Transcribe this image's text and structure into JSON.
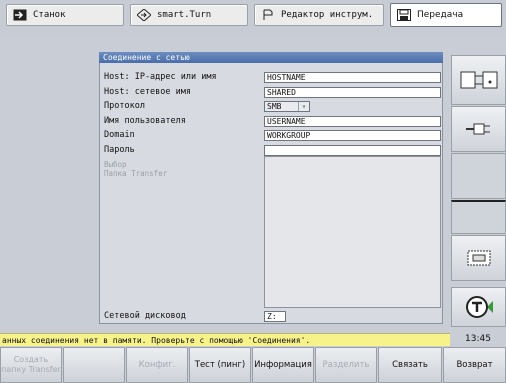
{
  "tabs": [
    {
      "label": "Станок",
      "icon": "arrow-right-icon"
    },
    {
      "label": "smart.Turn",
      "icon": "diamond-arrow-icon"
    },
    {
      "label": "Редактор инструм.",
      "icon": "tool-editor-icon"
    },
    {
      "label": "Передача",
      "icon": "transfer-icon"
    }
  ],
  "dialog": {
    "title": "Соединение с сетью",
    "rows": [
      {
        "label": "Host: IP-адрес или имя",
        "value": "HOSTNAME"
      },
      {
        "label": "Host: сетевое имя",
        "value": "SHARED"
      },
      {
        "label": "Протокол",
        "value": "SMB"
      },
      {
        "label": "Имя пользователя",
        "value": "USERNAME"
      },
      {
        "label": "Domain",
        "value": "WORKGROUP"
      },
      {
        "label": "Пароль",
        "value": ""
      }
    ],
    "dim_label_1": "Выбор",
    "dim_label_2": "Папка Transfer",
    "drive_label": "Сетевой дисковод",
    "drive_value": "Z:"
  },
  "status": {
    "message": "анных соединения нет в памяти. Проверьте с помощью 'Соединения'.",
    "time": "13:45"
  },
  "softkeys_bottom": [
    {
      "label": "Создать папку Transfer",
      "enabled": false
    },
    {
      "label": "",
      "enabled": false
    },
    {
      "label": "Конфиг.",
      "enabled": false
    },
    {
      "label": "Тест (пинг)",
      "enabled": true
    },
    {
      "label": "Информация",
      "enabled": true
    },
    {
      "label": "Разделить",
      "enabled": false
    },
    {
      "label": "Связать",
      "enabled": true
    },
    {
      "label": "Возврат",
      "enabled": true
    }
  ],
  "softkeys_right_icons": [
    "folder-transfer-icon",
    "connector-icon",
    "blank-key",
    "active-key",
    "network-drive-icon",
    "heidenhain-t-icon"
  ]
}
